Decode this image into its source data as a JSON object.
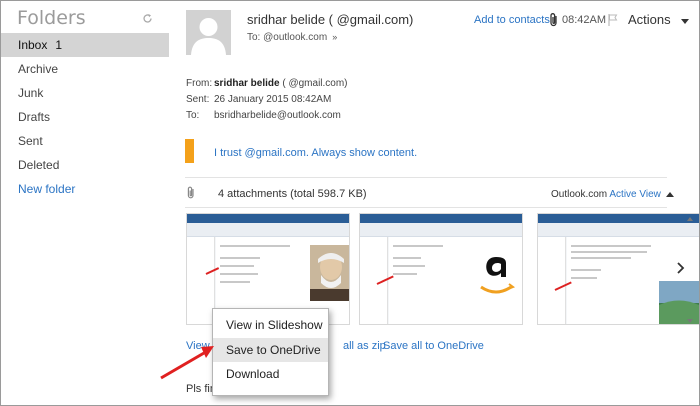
{
  "sidebar": {
    "title": "Folders",
    "refresh_icon": "refresh-icon",
    "items": [
      {
        "label": "Inbox",
        "count": "1",
        "selected": true
      },
      {
        "label": "Archive"
      },
      {
        "label": "Junk"
      },
      {
        "label": "Drafts"
      },
      {
        "label": "Sent"
      },
      {
        "label": "Deleted"
      }
    ],
    "new_folder": "New folder"
  },
  "message": {
    "sender_display": "sridhar belide  (              @gmail.com)",
    "add_to_contacts": "Add to contacts",
    "time": "08:42AM",
    "actions": "Actions",
    "to_line": "To:                         @outlook.com",
    "to_caret": "»",
    "from_label": "From:",
    "from_name": "sridhar belide",
    "from_email": " (             @gmail.com)",
    "sent_label": "Sent:",
    "sent_value": "26 January 2015 08:42AM",
    "to_label": "To:",
    "to_value": "bsridharbelide@outlook.com",
    "trust_text": "I trust                    @gmail.com. Always show content."
  },
  "attachments": {
    "summary": "4 attachments (total 598.7 KB)",
    "outlook_label": "Outlook.com",
    "active_view": "Active View",
    "view_slideshow_link": "View s",
    "download_zip_link": "all as zip",
    "save_all_link": "Save all to OneDrive"
  },
  "context_menu": {
    "items": [
      {
        "label": "View in Slideshow"
      },
      {
        "label": "Save to OneDrive",
        "hover": true
      },
      {
        "label": "Download"
      }
    ]
  },
  "body_text": "Pls fin",
  "colors": {
    "link": "#2b74c4",
    "trust_bar": "#f4a11a",
    "selected_folder": "#d4d4d4",
    "annotation_arrow": "#e02020"
  }
}
